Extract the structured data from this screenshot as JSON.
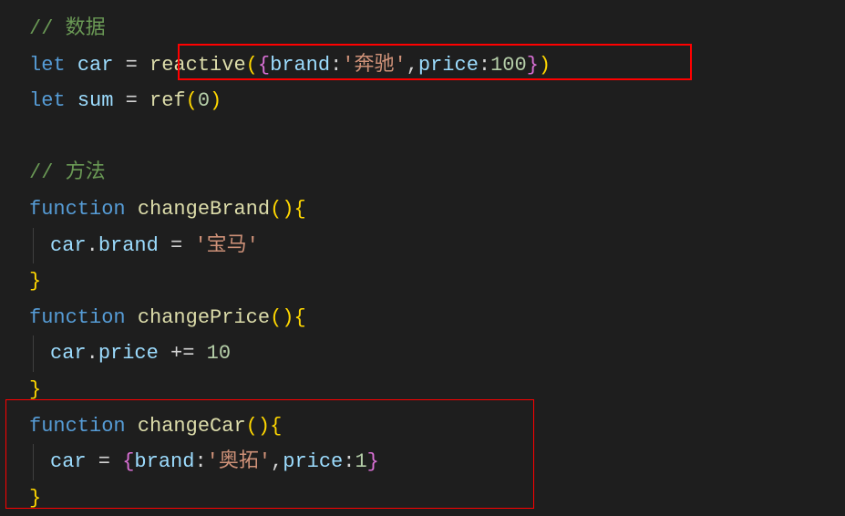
{
  "code": {
    "line1": {
      "comment": "// 数据"
    },
    "line2": {
      "keyword": "let",
      "var": "car",
      "equals": " = ",
      "func": "reactive",
      "openParen": "(",
      "openBrace": "{",
      "prop1": "brand",
      "colon1": ":",
      "string1": "'奔驰'",
      "comma": ",",
      "prop2": "price",
      "colon2": ":",
      "num": "100",
      "closeBrace": "}",
      "closeParen": ")"
    },
    "line3": {
      "keyword": "let",
      "var": "sum",
      "equals": " = ",
      "func": "ref",
      "openParen": "(",
      "num": "0",
      "closeParen": ")"
    },
    "line5": {
      "comment": "// 方法"
    },
    "line6": {
      "keyword": "function",
      "funcName": " changeBrand",
      "parens": "()",
      "openBrace": "{"
    },
    "line7": {
      "obj": "car",
      "dot": ".",
      "prop": "brand",
      "equals": " = ",
      "string": "'宝马'"
    },
    "line8": {
      "closeBrace": "}"
    },
    "line9": {
      "keyword": "function",
      "funcName": " changePrice",
      "parens": "()",
      "openBrace": "{"
    },
    "line10": {
      "obj": "car",
      "dot": ".",
      "prop": "price",
      "op": " += ",
      "num": "10"
    },
    "line11": {
      "closeBrace": "}"
    },
    "line12": {
      "keyword": "function",
      "funcName": " changeCar",
      "parens": "()",
      "openBrace": "{"
    },
    "line13": {
      "obj": "car",
      "equals": " = ",
      "cursor": "*",
      "openBrace": "{",
      "prop1": "brand",
      "colon1": ":",
      "string1": "'奥拓'",
      "comma": ",",
      "prop2": "price",
      "colon2": ":",
      "num": "1",
      "closeBrace": "}"
    },
    "line14": {
      "closeBrace": "}"
    }
  }
}
